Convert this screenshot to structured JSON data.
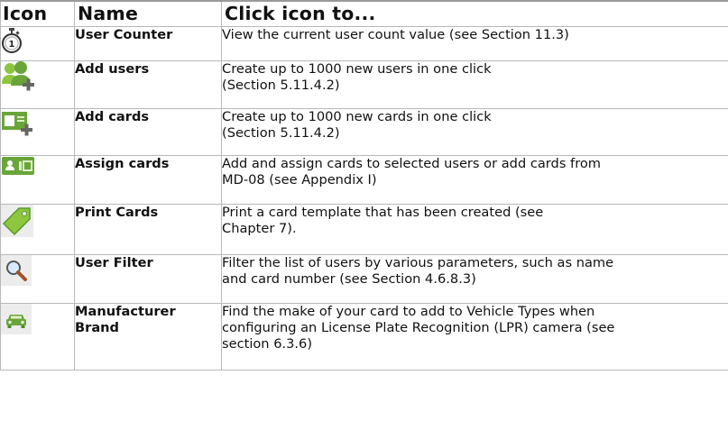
{
  "headers": {
    "icon": "Icon",
    "name": "Name",
    "action": "Click icon to..."
  },
  "rows": [
    {
      "icon": "stopwatch-icon",
      "name": "User Counter",
      "desc": [
        "View the current user count value (see Section 11.3)"
      ]
    },
    {
      "icon": "add-users-icon",
      "name": "Add users",
      "desc": [
        "Create up to 1000 new users in one click",
        "(Section 5.11.4.2)"
      ]
    },
    {
      "icon": "add-cards-icon",
      "name": "Add cards",
      "desc": [
        "Create up to 1000 new cards in one click",
        "(Section 5.11.4.2)"
      ]
    },
    {
      "icon": "assign-cards-icon",
      "name": "Assign cards",
      "desc": [
        "Add and assign cards to selected users or add cards from",
        "MD-08 (see Appendix I)"
      ]
    },
    {
      "icon": "price-tag-icon",
      "name": "Print Cards",
      "desc": [
        "Print a card template that has been created (see",
        "Chapter 7)."
      ]
    },
    {
      "icon": "magnifier-icon",
      "name": "User Filter",
      "desc": [
        "Filter the list of users by various parameters, such as name",
        "and card number (see Section 4.6.8.3)"
      ]
    },
    {
      "icon": "car-icon",
      "name": [
        "Manufacturer",
        "Brand"
      ],
      "desc": [
        "Find the make of your card to add to Vehicle Types when",
        "configuring an License Plate Recognition (LPR) camera (see",
        "section 6.3.6)"
      ]
    }
  ],
  "colors": {
    "green": "#6aa53a",
    "green_light": "#8dc63f",
    "border": "#b8b8b8"
  }
}
